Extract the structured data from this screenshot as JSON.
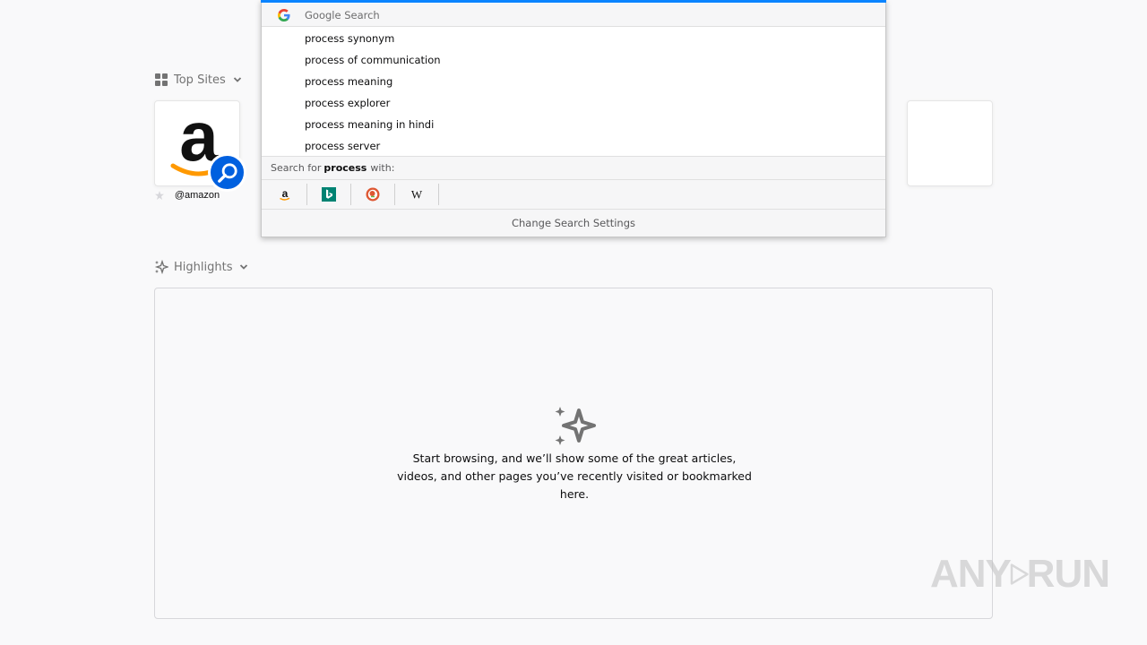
{
  "top_sites": {
    "header_label": "Top Sites",
    "tiles": [
      {
        "label": "@amazon",
        "icon": "amazon-logo"
      }
    ]
  },
  "highlights": {
    "header_label": "Highlights",
    "empty_message": "Start browsing, and we’ll show some of the great articles, videos, and other pages you’ve recently visited or bookmarked here."
  },
  "dropdown": {
    "heading": "Google Search",
    "suggestions": [
      "process synonym",
      "process of communication",
      "process meaning",
      "process explorer",
      "process meaning in hindi",
      "process server"
    ],
    "search_for_prefix": "Search for",
    "search_term": "process",
    "search_for_suffix": "with:",
    "engines": [
      "amazon",
      "bing",
      "duckduckgo",
      "wikipedia"
    ],
    "settings_label": "Change Search Settings"
  },
  "watermark": {
    "left": "ANY",
    "right": "RUN"
  },
  "colors": {
    "accent": "#0060df",
    "focus": "#0a84ff",
    "amazon_orange": "#ff9900",
    "bing_teal": "#008373",
    "ddg_orange": "#de5833"
  }
}
